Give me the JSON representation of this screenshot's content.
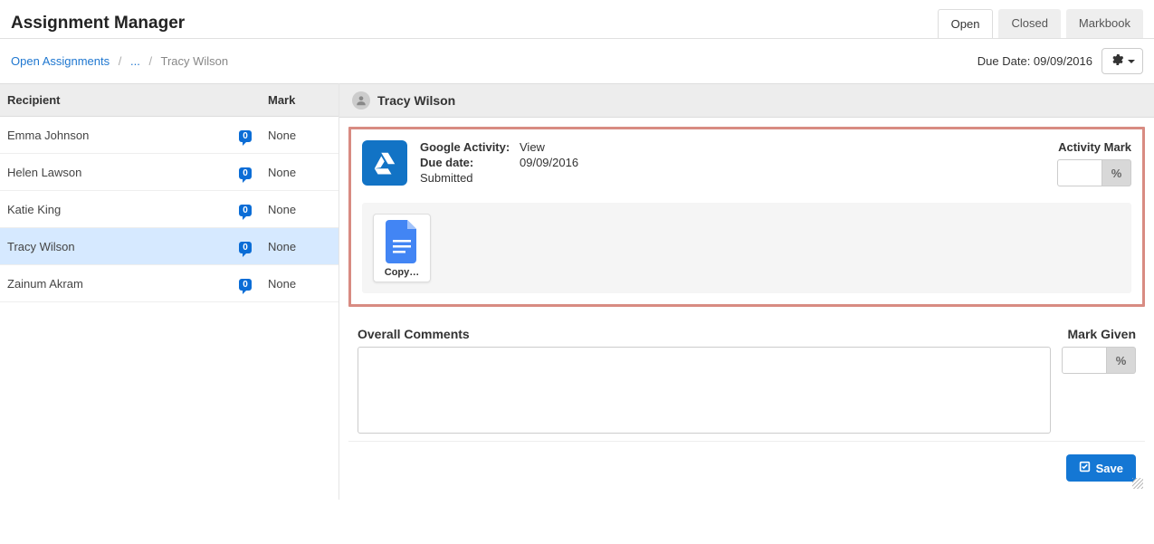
{
  "page_title": "Assignment Manager",
  "tabs": {
    "open": "Open",
    "closed": "Closed",
    "markbook": "Markbook"
  },
  "breadcrumb": {
    "root": "Open Assignments",
    "mid": "...",
    "current": "Tracy Wilson"
  },
  "due_date_label": "Due Date: 09/09/2016",
  "columns": {
    "recipient": "Recipient",
    "mark": "Mark"
  },
  "recipients": [
    {
      "name": "Emma Johnson",
      "comments": "0",
      "mark": "None"
    },
    {
      "name": "Helen Lawson",
      "comments": "0",
      "mark": "None"
    },
    {
      "name": "Katie King",
      "comments": "0",
      "mark": "None"
    },
    {
      "name": "Tracy Wilson",
      "comments": "0",
      "mark": "None"
    },
    {
      "name": "Zainum Akram",
      "comments": "0",
      "mark": "None"
    }
  ],
  "selected_index": 3,
  "student_name": "Tracy Wilson",
  "activity": {
    "label_activity": "Google Activity:",
    "activity_value": "View",
    "label_due": "Due date:",
    "due_value": "09/09/2016",
    "submitted": "Submitted",
    "mark_label": "Activity Mark",
    "pct": "%"
  },
  "file": {
    "name": "Copy…"
  },
  "comments": {
    "header": "Overall Comments",
    "mark_given": "Mark Given",
    "pct": "%"
  },
  "save_label": "Save"
}
